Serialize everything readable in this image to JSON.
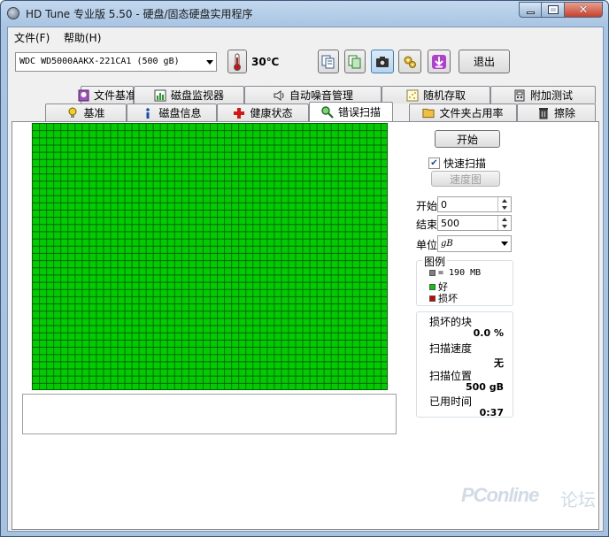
{
  "window": {
    "title": "HD Tune 专业版 5.50 - 硬盘/固态硬盘实用程序"
  },
  "menu": {
    "items": [
      {
        "label": "文件(F)"
      },
      {
        "label": "帮助(H)"
      }
    ]
  },
  "toolbar": {
    "drive": "WDC WD5000AAKX-221CA1 (500 gB)",
    "temperature": "30℃",
    "exit_label": "退出",
    "icons": [
      "copy-text-icon",
      "copy-screen-icon",
      "camera-icon",
      "options-icon",
      "download-icon"
    ]
  },
  "tabs": {
    "top_row": [
      "文件基准",
      "磁盘监视器",
      "自动噪音管理",
      "随机存取",
      "附加测试"
    ],
    "bottom_row": [
      "基准",
      "磁盘信息",
      "健康状态",
      "错误扫描",
      "文件夹占用率",
      "擦除"
    ],
    "active": "错误扫描"
  },
  "scan": {
    "block_status": "good",
    "colors": {
      "good": "#00cc00",
      "bad": "#d40000",
      "unit": "#808080",
      "grid_line": "#006600"
    }
  },
  "controls": {
    "start_label": "开始",
    "quick_scan_label": "快速扫描",
    "quick_scan_checked": true,
    "map_label": "速度图",
    "start_field_label": "开始",
    "start_value": "0",
    "end_field_label": "结束",
    "end_value": "500",
    "unit_label": "单位",
    "unit_value": "gB"
  },
  "legend": {
    "title": "图例",
    "block_size": "= 190 MB",
    "good_label": "好",
    "bad_label": "损坏"
  },
  "stats": {
    "damaged_label": "损坏的块",
    "damaged_value": "0.0 %",
    "speed_label": "扫描速度",
    "speed_value": "无",
    "position_label": "扫描位置",
    "position_value": "500 gB",
    "elapsed_label": "已用时间",
    "elapsed_value": "0:37"
  },
  "watermark": {
    "text": "PConline",
    "text2": "论坛"
  }
}
